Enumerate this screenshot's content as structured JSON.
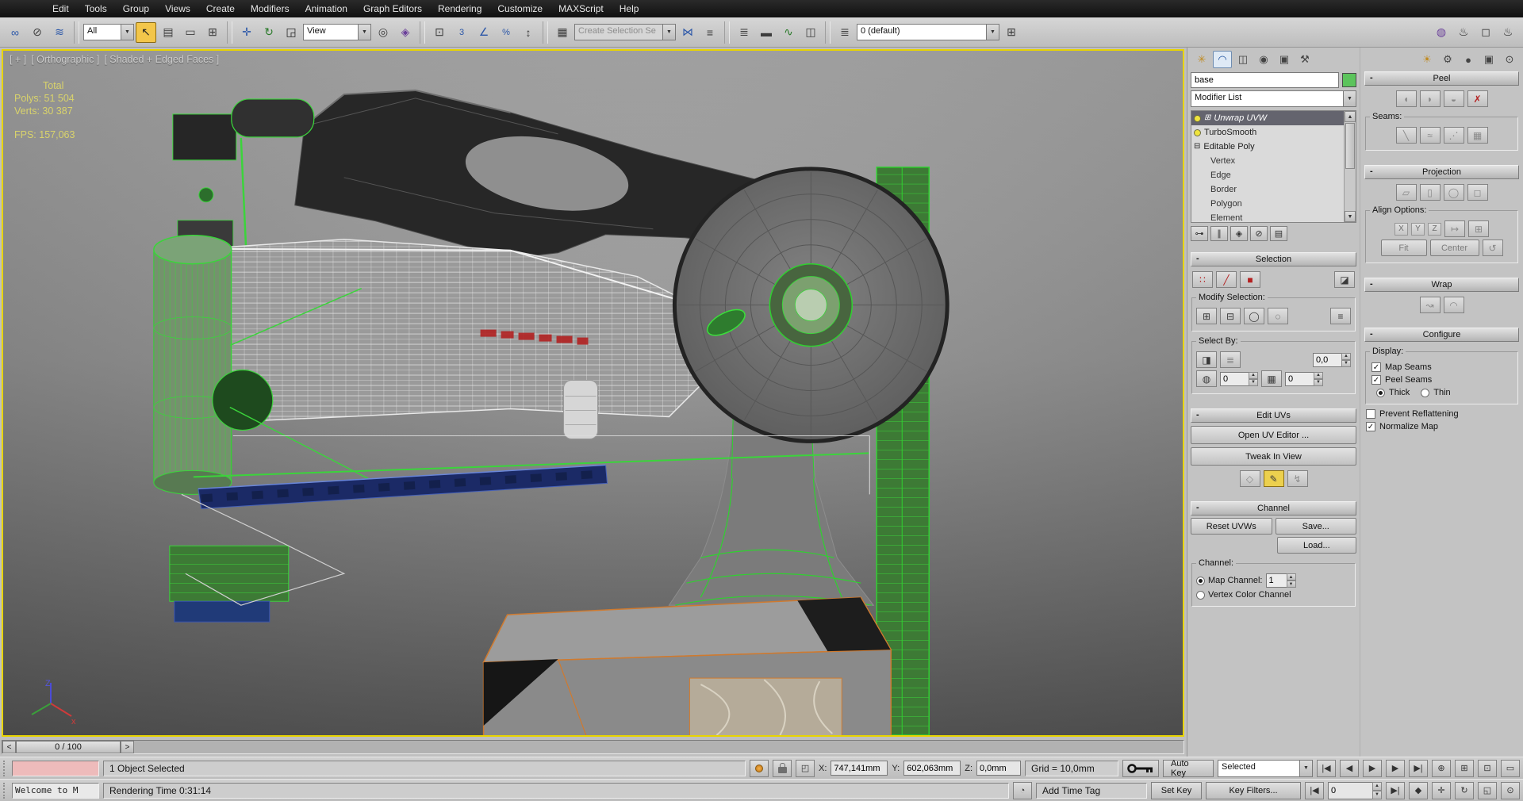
{
  "menu": {
    "items": [
      "Edit",
      "Tools",
      "Group",
      "Views",
      "Create",
      "Modifiers",
      "Animation",
      "Graph Editors",
      "Rendering",
      "Customize",
      "MAXScript",
      "Help"
    ]
  },
  "toolbar": {
    "selection_filter": "All",
    "reference_coordinate": "View",
    "named_selection_placeholder": "Create Selection Se",
    "layer_combo": "0 (default)"
  },
  "viewport": {
    "label_plus": "[ + ]",
    "label_view": "[ Orthographic ]",
    "label_shading": "[ Shaded + Edged Faces ]",
    "stats_total": "Total",
    "stats_polys": "Polys: 51 504",
    "stats_verts": "Verts: 30 387",
    "stats_fps": "FPS: 157,063",
    "axis_x": "x",
    "axis_z": "Z"
  },
  "command_panel": {
    "object_name": "base",
    "modifier_list": "Modifier List",
    "stack": [
      {
        "label": "Unwrap UVW"
      },
      {
        "label": "TurboSmooth"
      },
      {
        "label": "Editable Poly"
      },
      {
        "label": "Vertex"
      },
      {
        "label": "Edge"
      },
      {
        "label": "Border"
      },
      {
        "label": "Polygon"
      },
      {
        "label": "Element"
      }
    ],
    "selection": {
      "title": "Selection",
      "modify_selection": "Modify Selection:",
      "select_by": "Select By:",
      "angle_value": "0,0",
      "smooth_value": "0",
      "matid_value": "0"
    },
    "edit_uvs": {
      "title": "Edit UVs",
      "open_editor": "Open UV Editor ...",
      "tweak": "Tweak In View"
    },
    "channel": {
      "title": "Channel",
      "reset": "Reset UVWs",
      "save": "Save...",
      "load": "Load...",
      "group": "Channel:",
      "map_channel": "Map Channel:",
      "map_channel_value": "1",
      "vertex_color": "Vertex Color Channel"
    }
  },
  "right_panel": {
    "peel": {
      "title": "Peel",
      "seams": "Seams:"
    },
    "projection": {
      "title": "Projection",
      "align": "Align Options:",
      "x": "X",
      "y": "Y",
      "z": "Z",
      "fit": "Fit",
      "center": "Center"
    },
    "wrap": {
      "title": "Wrap"
    },
    "configure": {
      "title": "Configure",
      "display": "Display:",
      "map_seams": "Map Seams",
      "peel_seams": "Peel Seams",
      "thick": "Thick",
      "thin": "Thin",
      "prevent": "Prevent Reflattening",
      "normalize": "Normalize Map"
    }
  },
  "timeline": {
    "value": "0 / 100"
  },
  "status_bar": {
    "selection_status": "1 Object Selected",
    "x_label": "X:",
    "x_value": "747,141mm",
    "y_label": "Y:",
    "y_value": "602,063mm",
    "z_label": "Z:",
    "z_value": "0,0mm",
    "grid": "Grid = 10,0mm",
    "listener": "Welcome to M",
    "prompt": "Rendering Time 0:31:14",
    "add_time_tag": "Add Time Tag"
  },
  "animation": {
    "auto_key": "Auto Key",
    "set_key": "Set Key",
    "filter": "Selected",
    "key_filters": "Key Filters...",
    "frame": "0"
  },
  "icons": {
    "minus": "-",
    "dropdown": "▼",
    "spin_up": "▲",
    "spin_down": "▼",
    "check": "✓",
    "time_back": "<",
    "time_forward": ">",
    "link": "∞",
    "unlink": "⊘",
    "bind": "≋",
    "select": "↖",
    "select_by_name": "▤",
    "region": "▭",
    "crossing": "⊞",
    "move": "✛",
    "rotate": "↻",
    "scale": "◲",
    "center": "◎",
    "manipulate": "◈",
    "kbd": "⊡",
    "snap": "3",
    "angle_snap": "∠",
    "percent_snap": "%",
    "spinner_snap": "↕",
    "named_sets": "▦",
    "mirror": "⋈",
    "align": "≡",
    "layers": "≣",
    "ribbon": "▬",
    "curve_editor": "∿",
    "schematic": "◫",
    "new_layer": "⊞",
    "material": "◍",
    "render_setup": "♨",
    "frame_window": "◻",
    "render": "♨",
    "sun": "☀",
    "gear": "⚙",
    "sphere": "●",
    "monitor": "▣",
    "magnifier": "⊙",
    "tab_create": "✳",
    "tab_modify": "◠",
    "tab_hierarchy": "◫",
    "tab_motion": "◉",
    "tab_display": "▣",
    "tab_utilities": "⚒",
    "expand": "⊞",
    "collapse_box": "⊟",
    "pin": "⊶",
    "end_result": "∥",
    "unique": "◈",
    "trash": "⊘",
    "configure_sets": "▤",
    "vertex": "∷",
    "edge": "╱",
    "polygon": "■",
    "element": "◪",
    "grow": "⊞",
    "shrink": "⊟",
    "ring": "◯",
    "loop": "◌",
    "menu_lines": "≡",
    "menu_lines2": "≣",
    "planar": "◨",
    "smooth_group": "◍",
    "mat_id": "▦",
    "uv_move": "◇",
    "uv_edit": "✎",
    "uv_arrow": "↯",
    "peel1": "◖",
    "peel2": "◗",
    "peel3": "◒",
    "peel4": "✗",
    "seam1": "╲",
    "seam2": "≈",
    "seam3": "⋰",
    "seam4": "▦",
    "proj_plane": "▱",
    "proj_cyl": "▯",
    "proj_sphere": "◯",
    "proj_box": "◻",
    "align_a": "↦",
    "align_b": "⊞",
    "align_reset": "↺",
    "wrap1": "↝",
    "wrap2": "◠",
    "go_start": "|◀",
    "prev_frame": "◀",
    "play": "▶",
    "next_frame": "▶",
    "go_end": "▶|",
    "prev_key": "|◀",
    "next_key": "▶|",
    "key_mode": "◆",
    "zoom": "⊕",
    "zoom_all": "⊞",
    "zoom_extents": "⊡",
    "zoom_region": "▭",
    "pan": "✛",
    "orbit": "↻",
    "maximize": "◱",
    "abs_offset": "◰",
    "time_tag_icon": "◔"
  }
}
